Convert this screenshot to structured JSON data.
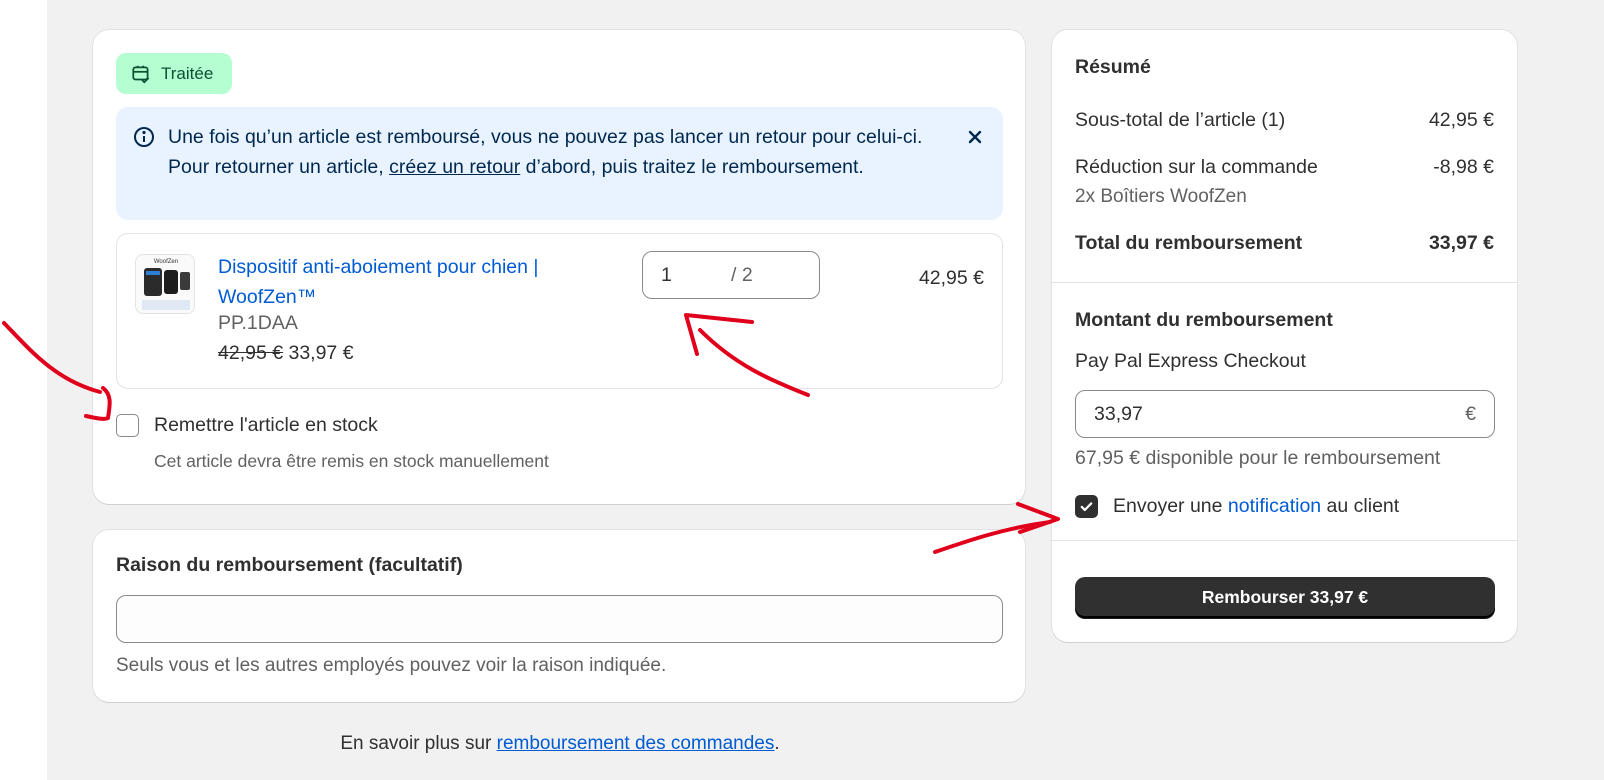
{
  "status_badge": {
    "label": "Traitée"
  },
  "banner": {
    "text_before": "Une fois qu’un article est remboursé, vous ne pouvez pas lancer un retour pour celui-ci. Pour retourner un article, ",
    "link": "créez un retour",
    "text_after": " d’abord, puis traitez le remboursement."
  },
  "line_item": {
    "thumb_text": "WoofZen",
    "title": "Dispositif anti-aboiement pour chien | WoofZen™",
    "sku": "PP.1DAA",
    "original_price": "42,95 €",
    "discounted_price": "33,97 €",
    "quantity": "1",
    "quantity_max": "/ 2",
    "line_total": "42,95 €"
  },
  "restock": {
    "label": "Remettre l'article en stock",
    "help": "Cet article devra être remis en stock manuellement",
    "checked": false
  },
  "reason": {
    "title": "Raison du remboursement (facultatif)",
    "value": "",
    "help": "Seuls vous et les autres employés pouvez voir la raison indiquée."
  },
  "summary": {
    "title": "Résumé",
    "subtotal_label": "Sous-total de l’article (1)",
    "subtotal_value": "42,95 €",
    "discount_label": "Réduction sur la commande",
    "discount_value": "-8,98 €",
    "discount_detail": "2x Boîtiers WoofZen",
    "total_label": "Total du remboursement",
    "total_value": "33,97 €"
  },
  "refund_amount": {
    "title": "Montant du remboursement",
    "method": "Pay Pal Express Checkout",
    "value": "33,97",
    "currency": "€",
    "available": "67,95 € disponible pour le remboursement"
  },
  "notify": {
    "text_before": "Envoyer une ",
    "link": "notification",
    "text_after": " au client",
    "checked": true
  },
  "refund_button": {
    "label": "Rembourser 33,97 €"
  },
  "footer": {
    "text": "En savoir plus sur ",
    "link": "remboursement des commandes",
    "end": "."
  },
  "colors": {
    "accent_link": "#005bd3",
    "badge_bg": "#b4fed2",
    "banner_bg": "#e8f3ff",
    "annotation": "#e0001b"
  }
}
